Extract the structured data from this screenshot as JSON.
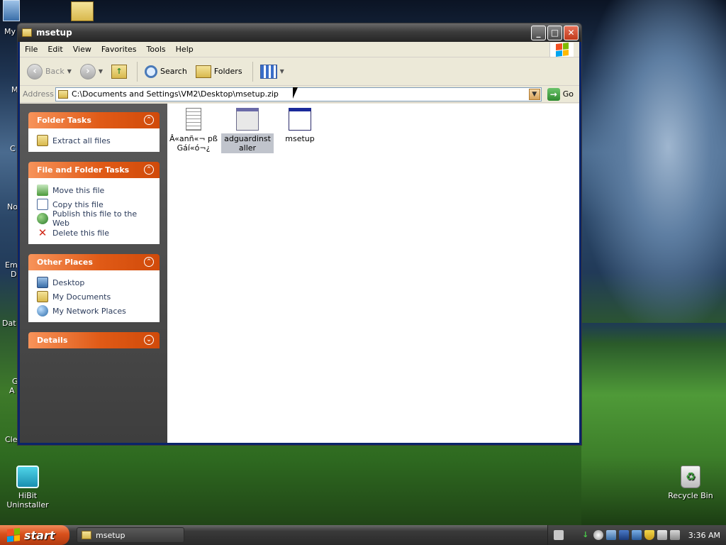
{
  "window": {
    "title": "msetup",
    "minimize_icon": "minimize-icon",
    "maximize_icon": "maximize-icon",
    "close_icon": "close-icon"
  },
  "menu": [
    "File",
    "Edit",
    "View",
    "Favorites",
    "Tools",
    "Help"
  ],
  "toolbar": {
    "back_label": "Back",
    "search_label": "Search",
    "folders_label": "Folders"
  },
  "address": {
    "label": "Address",
    "path": "C:\\Documents and Settings\\VM2\\Desktop\\msetup.zip",
    "go_label": "Go"
  },
  "tasks": {
    "folder_tasks": {
      "title": "Folder Tasks",
      "items": [
        {
          "label": "Extract all files",
          "icon": "extract-icon"
        }
      ]
    },
    "file_folder_tasks": {
      "title": "File and Folder Tasks",
      "items": [
        {
          "label": "Move this file",
          "icon": "move-icon"
        },
        {
          "label": "Copy this file",
          "icon": "copy-icon"
        },
        {
          "label": "Publish this file to the Web",
          "icon": "globe-icon"
        },
        {
          "label": "Delete this file",
          "icon": "delete-icon"
        }
      ]
    },
    "other_places": {
      "title": "Other Places",
      "items": [
        {
          "label": "Desktop",
          "icon": "desktop-icon"
        },
        {
          "label": "My Documents",
          "icon": "my-documents-icon"
        },
        {
          "label": "My Network Places",
          "icon": "network-icon"
        }
      ]
    },
    "details": {
      "title": "Details"
    }
  },
  "files": [
    {
      "name": "Â«anñ«¬ pßGáí«ó¬¿",
      "icon": "text-file-icon",
      "selected": false
    },
    {
      "name": "adguardinstaller",
      "icon": "application-icon",
      "selected": true
    },
    {
      "name": "msetup",
      "icon": "application-icon",
      "selected": false
    }
  ],
  "desktop": {
    "hibit_label": "HiBit Uninstaller",
    "recycle_label": "Recycle Bin",
    "left_partial": [
      "My",
      "M",
      "C",
      "No",
      "Em",
      "D",
      "Dat",
      "G",
      "A",
      "Cle"
    ]
  },
  "taskbar": {
    "start_label": "start",
    "task_item_label": "msetup",
    "clock": "3:36 AM"
  }
}
